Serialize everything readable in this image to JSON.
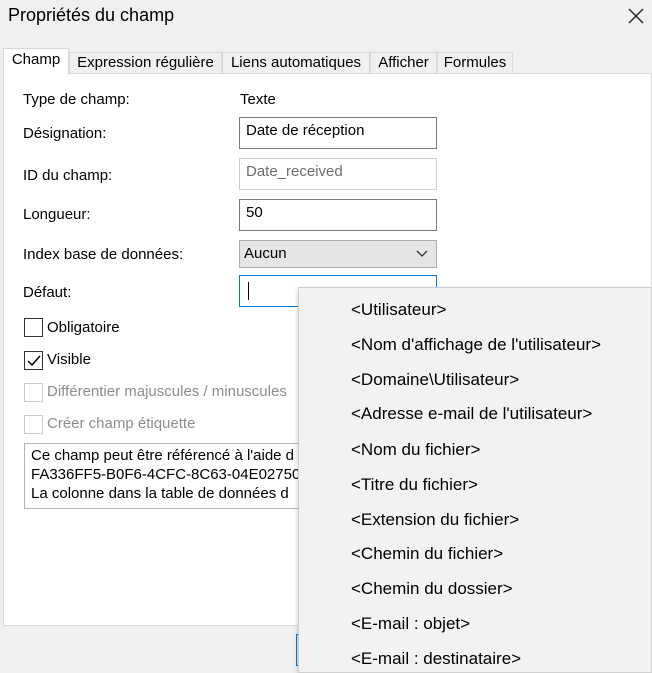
{
  "window": {
    "title": "Propriétés du champ"
  },
  "tabs": [
    {
      "label": "Champ",
      "active": true
    },
    {
      "label": "Expression régulière"
    },
    {
      "label": "Liens automatiques"
    },
    {
      "label": "Afficher"
    },
    {
      "label": "Formules"
    }
  ],
  "form": {
    "type_label": "Type de champ:",
    "type_value": "Texte",
    "designation_label": "Désignation:",
    "designation_value": "Date de réception",
    "id_label": "ID du champ:",
    "id_value": "Date_received",
    "length_label": "Longueur:",
    "length_value": "50",
    "index_label": "Index base de données:",
    "index_value": "Aucun",
    "default_label": "Défaut:",
    "default_value": ""
  },
  "checkboxes": [
    {
      "label": "Obligatoire",
      "checked": false,
      "enabled": true
    },
    {
      "label": "Visible",
      "checked": true,
      "enabled": true
    },
    {
      "label": "Différentier majuscules / minuscules",
      "checked": false,
      "enabled": false
    },
    {
      "label": "Créer champ étiquette",
      "checked": false,
      "enabled": false
    }
  ],
  "description": {
    "line1": "Ce champ peut être référencé à l'aide d",
    "line2": "FA336FF5-B0F6-4CFC-8C63-04E02750",
    "line3": "La colonne dans la table de données d"
  },
  "dropdown": {
    "items": [
      "<Utilisateur>",
      "<Nom d'affichage de l'utilisateur>",
      "<Domaine\\Utilisateur>",
      "<Adresse e-mail de l'utilisateur>",
      "<Nom du fichier>",
      "<Titre du fichier>",
      "<Extension du fichier>",
      "<Chemin du fichier>",
      "<Chemin du dossier>",
      "<E-mail : objet>",
      "<E-mail : destinataire>"
    ]
  },
  "colors": {
    "accent": "#0078d7",
    "background": "#f0f0f0"
  }
}
